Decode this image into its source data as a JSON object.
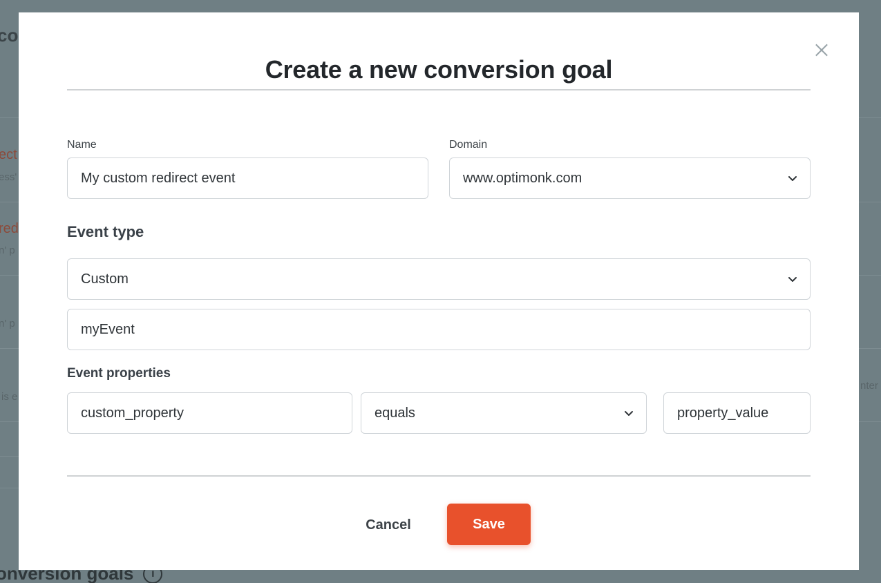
{
  "background": {
    "title_fragment": "co",
    "row_fragments": [
      "ect",
      "ess'",
      "red",
      "n' p",
      "n' p",
      "is e",
      "nter"
    ],
    "bottom_heading": "onversion goals",
    "info_icon": "info-icon"
  },
  "modal": {
    "title": "Create a new conversion goal",
    "close_icon": "close-icon"
  },
  "form": {
    "name_label": "Name",
    "name_value": "My custom redirect event",
    "domain_label": "Domain",
    "domain_value": "www.optimonk.com",
    "event_type_label": "Event type",
    "event_type_value": "Custom",
    "event_name_value": "myEvent",
    "event_properties_label": "Event properties",
    "property_name_value": "custom_property",
    "operator_value": "equals",
    "property_value": "property_value"
  },
  "actions": {
    "cancel_label": "Cancel",
    "save_label": "Save"
  },
  "colors": {
    "accent": "#e8512c",
    "overlay": "#6f7f84"
  }
}
